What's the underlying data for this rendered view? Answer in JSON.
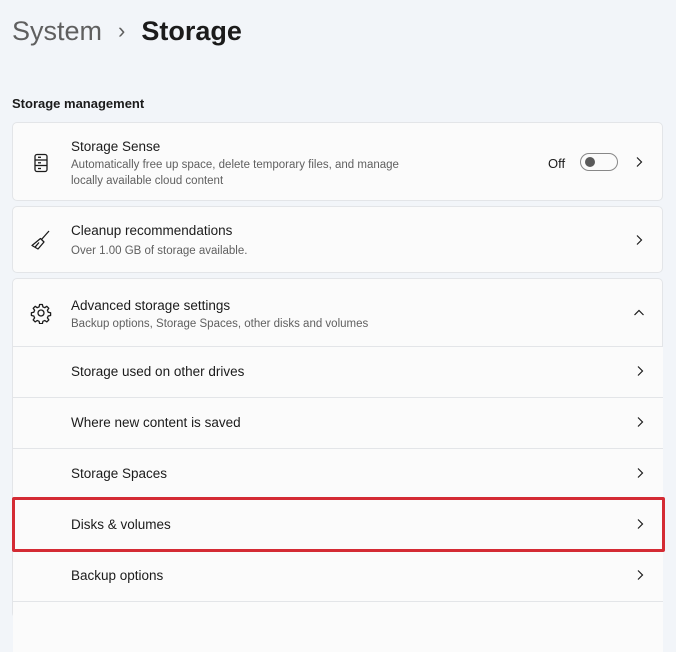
{
  "breadcrumb": {
    "parent": "System",
    "separator": "›",
    "current": "Storage"
  },
  "section_heading": "Storage management",
  "storage_sense": {
    "title": "Storage Sense",
    "desc_line1": "Automatically free up space, delete temporary files, and manage",
    "desc_line2": "locally available cloud content",
    "toggle_label": "Off",
    "toggle_state": "off"
  },
  "cleanup": {
    "title": "Cleanup recommendations",
    "desc": "Over 1.00 GB of storage available."
  },
  "advanced": {
    "title": "Advanced storage settings",
    "desc": "Backup options, Storage Spaces, other disks and volumes",
    "expanded": true
  },
  "sub_items": [
    {
      "label": "Storage used on other drives"
    },
    {
      "label": "Where new content is saved"
    },
    {
      "label": "Storage Spaces"
    },
    {
      "label": "Disks & volumes",
      "highlighted": true
    },
    {
      "label": "Backup options"
    }
  ],
  "colors": {
    "background": "#f2f5f9",
    "card": "#fbfbfb",
    "highlight": "#d42b34"
  }
}
